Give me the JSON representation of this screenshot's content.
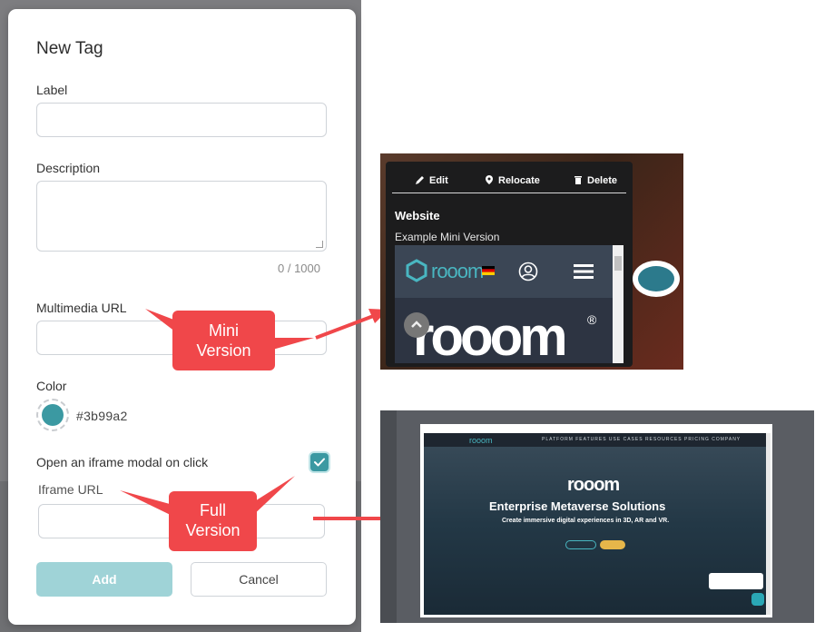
{
  "modal": {
    "title": "New Tag",
    "label_field": {
      "label": "Label",
      "value": ""
    },
    "description_field": {
      "label": "Description",
      "value": "",
      "counter": "0 / 1000"
    },
    "multimedia_field": {
      "label": "Multimedia URL",
      "value": ""
    },
    "color_field": {
      "label": "Color",
      "hex": "#3b99a2"
    },
    "iframe_option": {
      "label": "Open an iframe modal on click",
      "checked": true
    },
    "iframe_field": {
      "label": "Iframe URL",
      "value": ""
    },
    "buttons": {
      "add": "Add",
      "cancel": "Cancel"
    }
  },
  "callouts": {
    "mini_line1": "Mini",
    "mini_line2": "Version",
    "full_line1": "Full",
    "full_line2": "Version"
  },
  "mini_preview": {
    "toolbar": {
      "edit": "Edit",
      "relocate": "Relocate",
      "delete": "Delete"
    },
    "title": "Website",
    "subtitle": "Example Mini Version",
    "brand": "rooom",
    "big_logo": "rooom",
    "reg_mark": "®"
  },
  "full_preview": {
    "logo": "rooom",
    "nav_links": "PLATFORM  FEATURES  USE CASES  RESOURCES  PRICING  COMPANY",
    "brand": "rooom",
    "headline": "Enterprise Metaverse Solutions",
    "tagline": "Create immersive digital experiences in 3D, AR and VR."
  },
  "colors": {
    "accent": "#3b99a2",
    "callout": "#f0474a",
    "add_button": "#9fd3d7"
  }
}
